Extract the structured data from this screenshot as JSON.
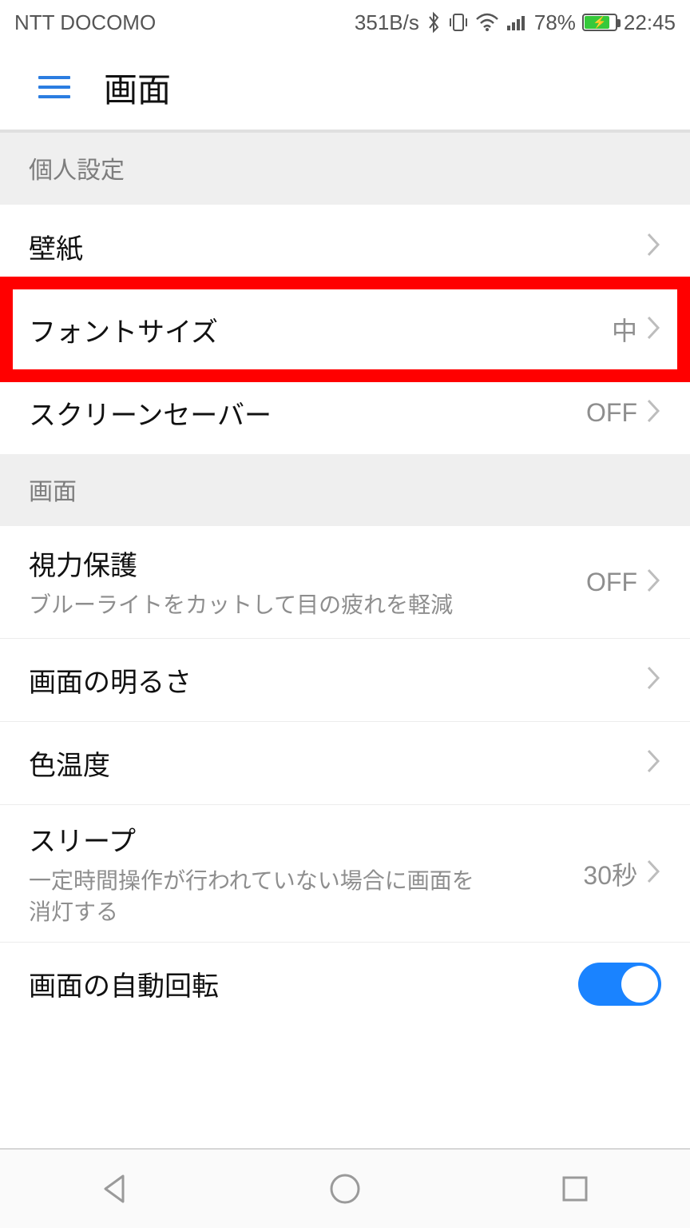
{
  "status": {
    "carrier": "NTT DOCOMO",
    "speed": "351B/s",
    "battery_pct": "78%",
    "time": "22:45"
  },
  "header": {
    "title": "画面"
  },
  "sections": [
    {
      "header": "個人設定",
      "items": [
        {
          "label": "壁紙",
          "value": "",
          "desc": "",
          "highlight": false,
          "toggle": false
        },
        {
          "label": "フォントサイズ",
          "value": "中",
          "desc": "",
          "highlight": true,
          "toggle": false
        },
        {
          "label": "スクリーンセーバー",
          "value": "OFF",
          "desc": "",
          "highlight": false,
          "toggle": false
        }
      ]
    },
    {
      "header": "画面",
      "items": [
        {
          "label": "視力保護",
          "value": "OFF",
          "desc": "ブルーライトをカットして目の疲れを軽減",
          "highlight": false,
          "toggle": false
        },
        {
          "label": "画面の明るさ",
          "value": "",
          "desc": "",
          "highlight": false,
          "toggle": false
        },
        {
          "label": "色温度",
          "value": "",
          "desc": "",
          "highlight": false,
          "toggle": false
        },
        {
          "label": "スリープ",
          "value": "30秒",
          "desc": "一定時間操作が行われていない場合に画面を消灯する",
          "highlight": false,
          "toggle": false
        },
        {
          "label": "画面の自動回転",
          "value": "",
          "desc": "",
          "highlight": false,
          "toggle": true,
          "toggle_on": true
        }
      ]
    }
  ]
}
